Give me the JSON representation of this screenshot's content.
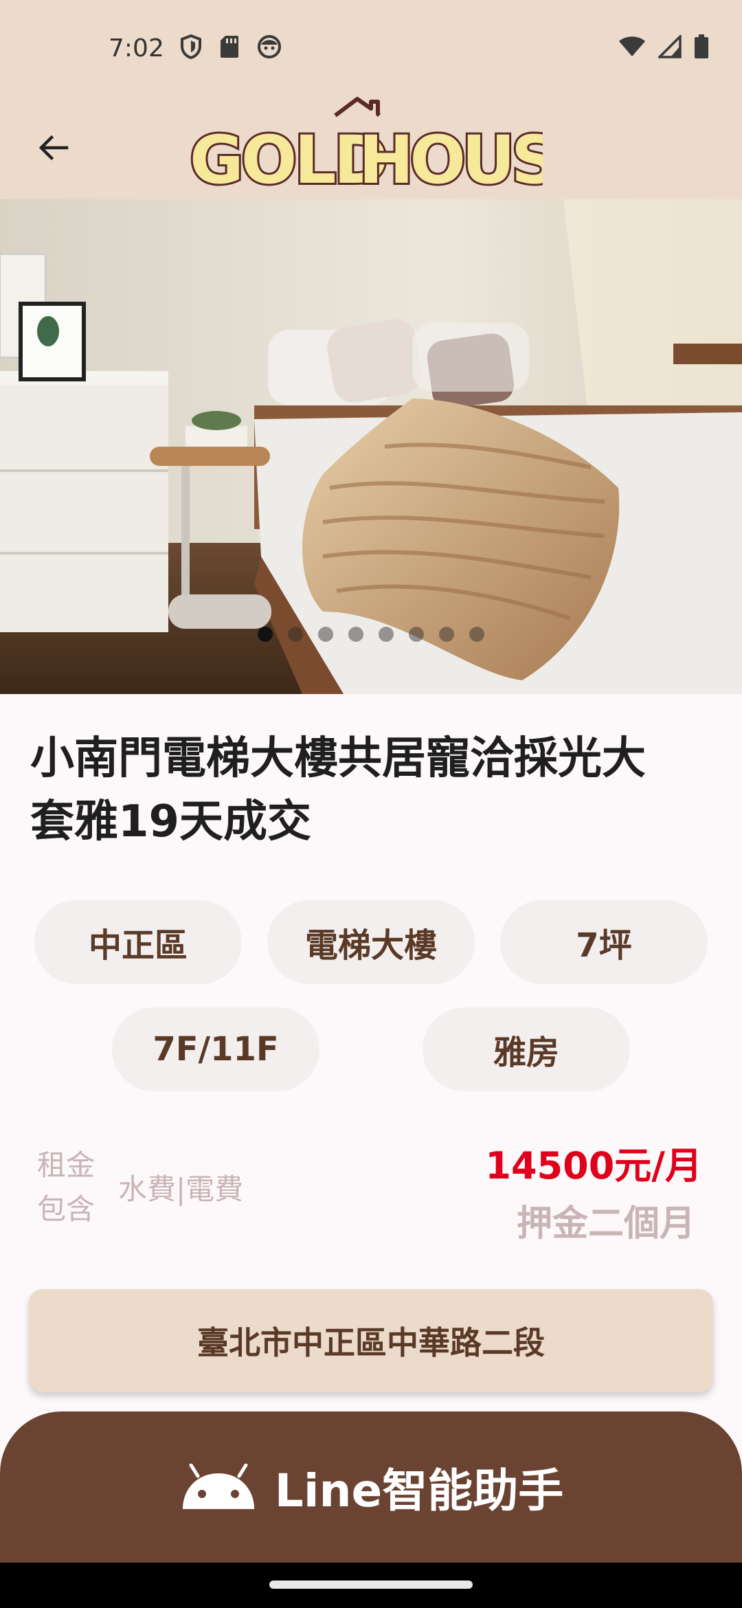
{
  "status_bar": {
    "time": "7:02",
    "left_icons": [
      "shield-icon",
      "sim-card-icon",
      "face-icon"
    ],
    "right_icons": [
      "wifi-icon",
      "signal-icon",
      "battery-icon"
    ]
  },
  "app_bar": {
    "back_icon": "arrow-left-icon",
    "logo_text_part1": "GOLD",
    "logo_text_part2": "HOUSE",
    "colors": {
      "background": "#ecdacb",
      "logo_fill": "#f6e99a",
      "logo_outline": "#5a2a2a"
    }
  },
  "gallery": {
    "image_count": 8,
    "active_index": 0
  },
  "listing": {
    "title_line1": "小南門電梯大樓共居寵洽採光大",
    "title_line2": "套雅19天成交",
    "tags": [
      "中正區",
      "電梯大樓",
      "7坪",
      "7F/11F",
      "雅房"
    ],
    "rent_label_line1": "租金",
    "rent_label_line2": "包含",
    "rent_includes": "水費|電費",
    "price": "14500元/月",
    "deposit": "押金二個月",
    "address": "臺北市中正區中華路二段",
    "colors": {
      "price": "#e0001b",
      "muted": "#c9b4b6",
      "chip_text": "#5a3a27"
    }
  },
  "line_assistant": {
    "label": "Line智能助手",
    "icon": "android-icon",
    "color": "#6b4332"
  }
}
